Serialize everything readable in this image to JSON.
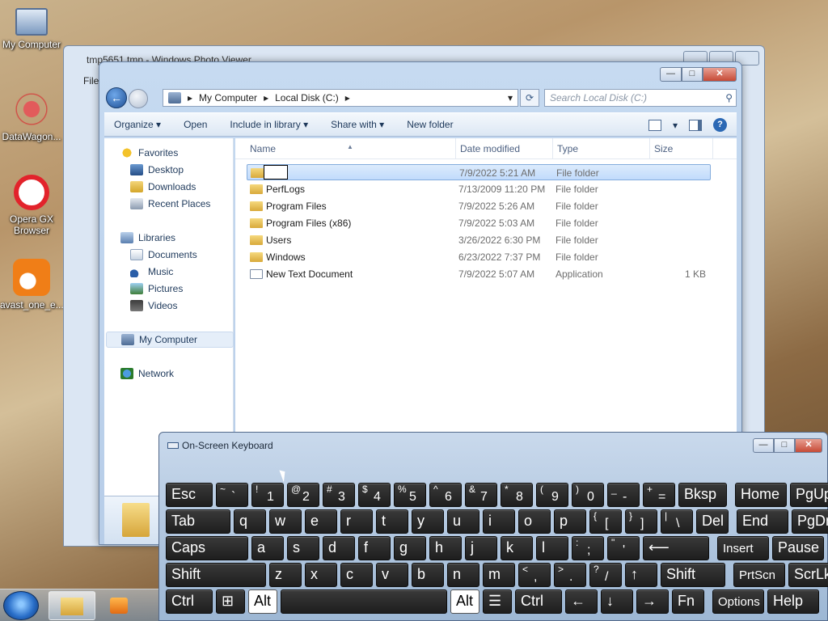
{
  "desktop": {
    "icons": [
      {
        "label": "My Computer"
      },
      {
        "label": "DataWagon..."
      },
      {
        "label": "Opera GX Browser"
      },
      {
        "label": "avast_one_e..."
      }
    ]
  },
  "photo_viewer": {
    "title": "tmp5651.tmp - Windows Photo Viewer",
    "file_menu": "File"
  },
  "explorer": {
    "breadcrumb": [
      "My Computer",
      "Local Disk (C:)"
    ],
    "search_placeholder": "Search Local Disk (C:)",
    "toolbar": {
      "organize": "Organize ▾",
      "open": "Open",
      "include": "Include in library ▾",
      "share": "Share with ▾",
      "new_folder": "New folder"
    },
    "nav": {
      "favorites": "Favorites",
      "desktop": "Desktop",
      "downloads": "Downloads",
      "recent": "Recent Places",
      "libraries": "Libraries",
      "documents": "Documents",
      "music": "Music",
      "pictures": "Pictures",
      "videos": "Videos",
      "computer": "My Computer",
      "network": "Network"
    },
    "columns": {
      "name": "Name",
      "date": "Date modified",
      "type": "Type",
      "size": "Size"
    },
    "rows": [
      {
        "name": "",
        "date": "7/9/2022 5:21 AM",
        "type": "File folder",
        "size": ""
      },
      {
        "name": "PerfLogs",
        "date": "7/13/2009 11:20 PM",
        "type": "File folder",
        "size": ""
      },
      {
        "name": "Program Files",
        "date": "7/9/2022 5:26 AM",
        "type": "File folder",
        "size": ""
      },
      {
        "name": "Program Files (x86)",
        "date": "7/9/2022 5:03 AM",
        "type": "File folder",
        "size": ""
      },
      {
        "name": "Users",
        "date": "3/26/2022 6:30 PM",
        "type": "File folder",
        "size": ""
      },
      {
        "name": "Windows",
        "date": "6/23/2022 7:37 PM",
        "type": "File folder",
        "size": ""
      },
      {
        "name": "New Text Document",
        "date": "7/9/2022 5:07 AM",
        "type": "Application",
        "size": "1 KB"
      }
    ]
  },
  "osk": {
    "title": "On-Screen Keyboard",
    "row1": [
      "Esc",
      "~`",
      "!1",
      "@2",
      "#3",
      "$4",
      "%5",
      "^6",
      "&7",
      "*8",
      "(9",
      ")0",
      "_-",
      "+=",
      "Bksp",
      "Home",
      "PgUp"
    ],
    "row2": [
      "Tab",
      "q",
      "w",
      "e",
      "r",
      "t",
      "y",
      "u",
      "i",
      "o",
      "p",
      "{[",
      "}]",
      "|\\",
      "Del",
      "End",
      "PgDn"
    ],
    "row3": [
      "Caps",
      "a",
      "s",
      "d",
      "f",
      "g",
      "h",
      "j",
      "k",
      "l",
      ":;",
      "\"'",
      "⟵",
      "Insert",
      "Pause"
    ],
    "row4": [
      "Shift",
      "z",
      "x",
      "c",
      "v",
      "b",
      "n",
      "m",
      "<,",
      ">.",
      "?/",
      "↑",
      "Shift",
      "PrtScn",
      "ScrLk"
    ],
    "row5": [
      "Ctrl",
      "⊞",
      "Alt",
      "",
      "Alt",
      "☰",
      "Ctrl",
      "←",
      "↓",
      "→",
      "Fn",
      "Options",
      "Help"
    ]
  }
}
